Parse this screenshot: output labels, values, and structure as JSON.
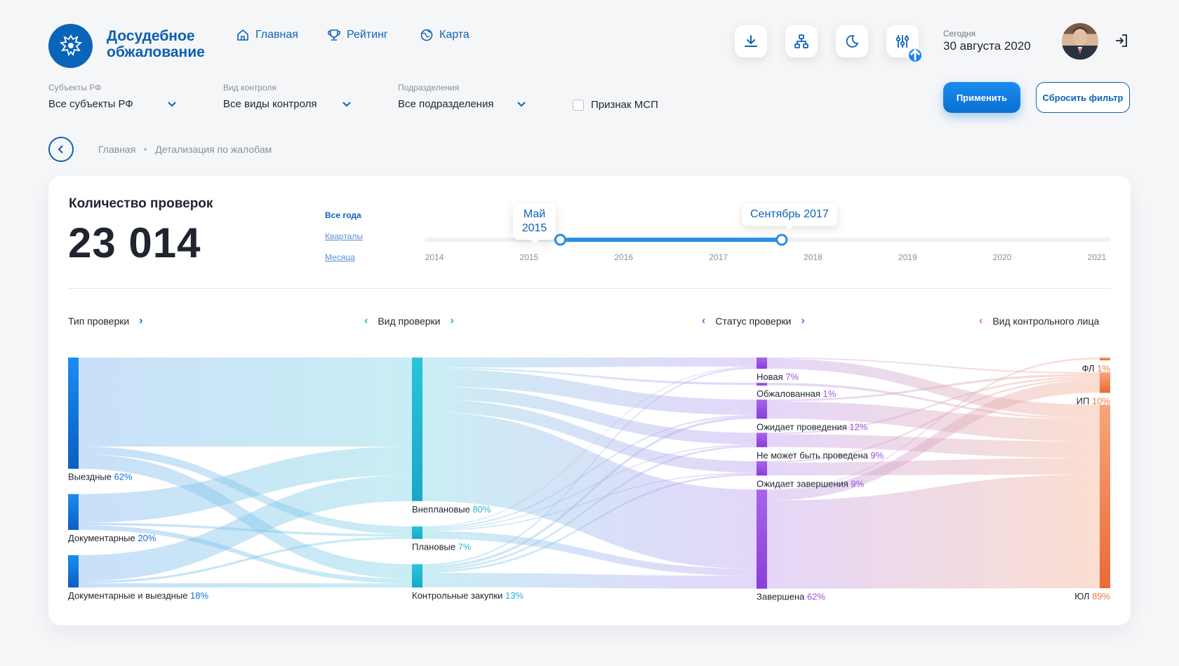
{
  "brand": {
    "line1": "Досудебное",
    "line2": "обжалование"
  },
  "nav": [
    {
      "label": "Главная",
      "icon": "home-icon"
    },
    {
      "label": "Рейтинг",
      "icon": "trophy-icon"
    },
    {
      "label": "Карта",
      "icon": "globe-icon"
    }
  ],
  "toolbar": {
    "icons": [
      "download-icon",
      "hierarchy-icon",
      "moon-icon",
      "settings-sliders-icon"
    ]
  },
  "today": {
    "label": "Сегодня",
    "date": "30 августа 2020"
  },
  "filters": [
    {
      "label": "Субъекты РФ",
      "value": "Все субъекты РФ"
    },
    {
      "label": "Вид контроля",
      "value": "Все виды контроля"
    },
    {
      "label": "Подразделения",
      "value": "Все подразделения"
    }
  ],
  "msp": {
    "label": "Признак МСП",
    "checked": false
  },
  "buttons": {
    "apply": "Применить",
    "reset": "Сбросить фильтр"
  },
  "breadcrumb": {
    "home": "Главная",
    "current": "Детализация по жалобам"
  },
  "card": {
    "title": "Количество проверок",
    "value": "23 014"
  },
  "periods": {
    "all": "Все года",
    "quarters": "Кварталы",
    "months": "Месяца"
  },
  "timeline": {
    "years": [
      "2014",
      "2015",
      "2016",
      "2017",
      "2018",
      "2019",
      "2020",
      "2021"
    ],
    "start_label": "Май 2015",
    "start_line1": "Май",
    "start_line2": "2015",
    "end_label": "Сентябрь 2017",
    "range_start": 2015.33,
    "range_end": 2017.67
  },
  "columns": [
    "Тип проверки",
    "Вид проверки",
    "Статус проверки",
    "Вид контрольного лица"
  ],
  "colors": {
    "col1": "#0a72d6",
    "col2": "#22b8d2",
    "col3": "#9a4fe0",
    "col4": "#ef7a45",
    "brand": "#0d62b5"
  },
  "chart_data": {
    "type": "sankey",
    "stages": [
      {
        "name": "Тип проверки",
        "nodes": [
          {
            "label": "Выездные",
            "pct": "62%",
            "value": 62
          },
          {
            "label": "Документарные",
            "pct": "20%",
            "value": 20
          },
          {
            "label": "Документарные и выездные",
            "pct": "18%",
            "value": 18
          }
        ]
      },
      {
        "name": "Вид проверки",
        "nodes": [
          {
            "label": "Внеплановые",
            "pct": "80%",
            "value": 80
          },
          {
            "label": "Плановые",
            "pct": "7%",
            "value": 7
          },
          {
            "label": "Контрольные закупки",
            "pct": "13%",
            "value": 13
          }
        ]
      },
      {
        "name": "Статус проверки",
        "nodes": [
          {
            "label": "Новая",
            "pct": "7%",
            "value": 7
          },
          {
            "label": "Обжалованная",
            "pct": "1%",
            "value": 1
          },
          {
            "label": "Ожидает проведения",
            "pct": "12%",
            "value": 12
          },
          {
            "label": "Не может быть проведена",
            "pct": "9%",
            "value": 9
          },
          {
            "label": "Ожидает завершения",
            "pct": "9%",
            "value": 9
          },
          {
            "label": "Завершена",
            "pct": "62%",
            "value": 62
          }
        ]
      },
      {
        "name": "Вид контрольного лица",
        "nodes": [
          {
            "label": "ФЛ",
            "pct": "1%",
            "value": 1
          },
          {
            "label": "ИП",
            "pct": "10%",
            "value": 10
          },
          {
            "label": "ЮЛ",
            "pct": "89%",
            "value": 89
          }
        ]
      }
    ]
  }
}
